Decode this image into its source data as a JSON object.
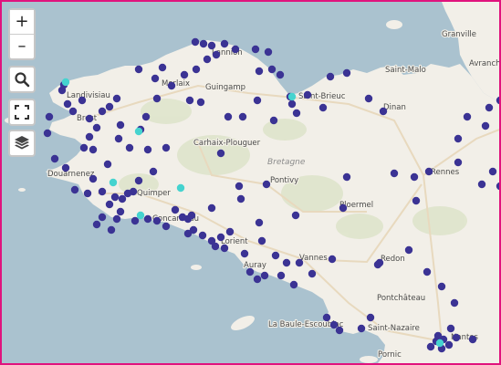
{
  "map": {
    "colors": {
      "sea": "#aac2cf",
      "land": "#f2efe8",
      "forest": "#dfe4cc",
      "road": "#e8d9be",
      "marker": "#3b3394",
      "marker_highlight": "#45d3cf",
      "frame": "#e0137d"
    },
    "controls": {
      "zoom_in": "+",
      "zoom_out": "–",
      "search": "search-icon",
      "fullscreen": "fullscreen-icon",
      "layers": "layers-icon"
    },
    "region_label": "Bretagne",
    "places": [
      "Granville",
      "Lannion",
      "Saint-Malo",
      "Avranche",
      "Landivisiau",
      "Morlaix",
      "Guingamp",
      "Saint-Brieuc",
      "Brest",
      "Dinan",
      "Carhaix-Plouguer",
      "Douarnenez",
      "Quimper",
      "Pontivy",
      "Rennes",
      "Concarneau",
      "Ploermel",
      "Lorient",
      "Vannes",
      "Redon",
      "Auray",
      "Pontchâteau",
      "La Baule-Escoublac",
      "Saint-Nazaire",
      "Pornic",
      "Nantes"
    ]
  }
}
